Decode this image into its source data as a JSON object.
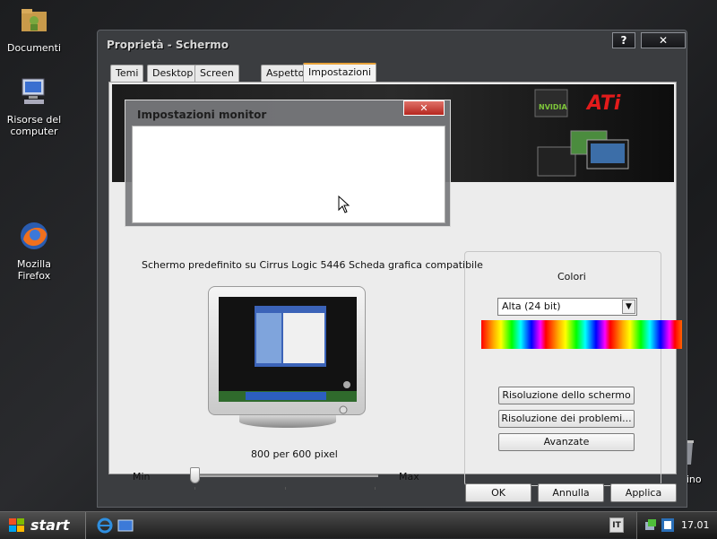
{
  "desktop": {
    "icons": [
      {
        "label": "Documenti"
      },
      {
        "label": "Risorse del computer"
      },
      {
        "label": "Mozilla Firefox"
      },
      {
        "label": "Cestino"
      }
    ]
  },
  "window": {
    "title": "Proprietà - Schermo",
    "help_label": "?",
    "close_label": "✕",
    "tabs": [
      {
        "label": "Temi"
      },
      {
        "label": "Desktop"
      },
      {
        "label": "Screen saver"
      },
      {
        "label": "Aspetto"
      },
      {
        "label": "Impostazioni"
      }
    ],
    "active_tab": "Impostazioni",
    "banner": {
      "nvidia": "NVIDIA",
      "ati": "ATi"
    },
    "monitor_dialog": {
      "title": "Impostazioni monitor",
      "close_label": "✕"
    },
    "monitor_desc": "Schermo predefinito su Cirrus Logic 5446 Scheda grafica compatibile",
    "resolution": {
      "text": "800 per 600 pixel",
      "min_label": "Min",
      "max_label": "Max",
      "slider_level": 0
    },
    "colors": {
      "label": "Colori",
      "selected": "Alta (24 bit)"
    },
    "buttons": {
      "screen_resolution": "Risoluzione dello schermo",
      "troubleshoot": "Risoluzione dei problemi...",
      "advanced": "Avanzate"
    },
    "footer": {
      "ok": "OK",
      "cancel": "Annulla",
      "apply": "Applica"
    }
  },
  "taskbar": {
    "start_label": "start",
    "language": "IT",
    "clock": "17.01"
  }
}
